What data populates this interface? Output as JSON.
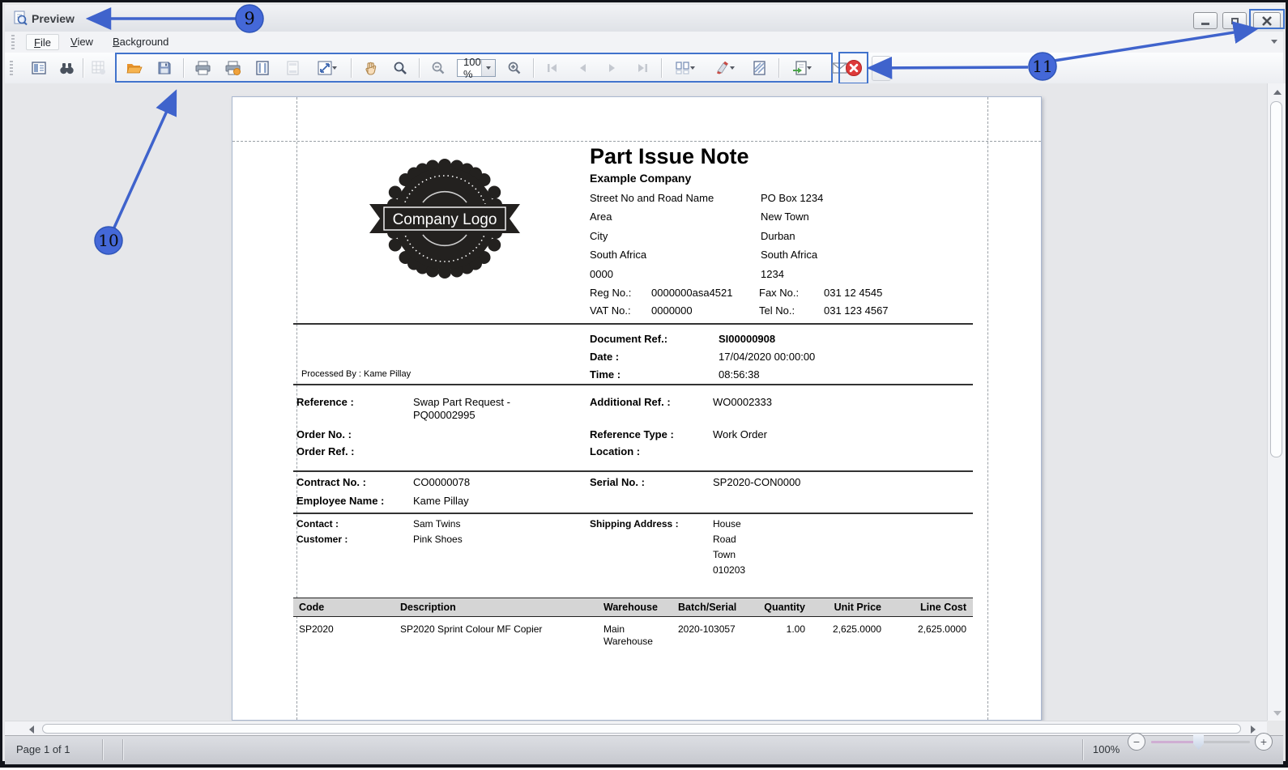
{
  "window": {
    "title": "Preview"
  },
  "menubar": {
    "items": [
      {
        "key": "F",
        "rest": "ile"
      },
      {
        "key": "V",
        "rest": "iew"
      },
      {
        "key": "B",
        "rest": "ackground"
      }
    ]
  },
  "toolbar": {
    "zoom_value": "100 %"
  },
  "statusbar": {
    "page_info": "Page 1 of 1",
    "zoom_label": "100%"
  },
  "annotations": {
    "n9": "9",
    "n10": "10",
    "n11": "11"
  },
  "logo": {
    "text": "Company Logo"
  },
  "icons": {
    "title": "preview-magnifier",
    "document_map": "split-panels",
    "search": "binoculars",
    "customize": "grid-gear",
    "open": "folder",
    "save": "floppy",
    "print": "printer",
    "quick_print": "printer-badge",
    "page_setup": "page-margins",
    "header_footer": "page-bands",
    "scale": "diagonal-arrows",
    "hand_tool": "hand",
    "magnifier": "magnifier",
    "zoom_out": "magnifier-minus",
    "zoom_in": "magnifier-plus",
    "first_page": "bar-left-arrow",
    "previous_page": "left-arrow",
    "next_page": "right-arrow",
    "last_page": "bar-right-arrow",
    "multiple_pages": "pages-grid",
    "page_color": "highlighter",
    "watermark": "page-hatch",
    "export": "page-export-arrow",
    "email": "envelope",
    "close_preview": "red-circle-x",
    "minimize": "dash",
    "maximize": "square",
    "close_window": "x"
  },
  "colors": {
    "annotation": "#3f63cc",
    "highlight": "#4173cc",
    "close_red": "#dd3a3a",
    "folder_orange": "#f0a23c",
    "header_band": "#d5d5d5"
  },
  "doc": {
    "title": "Part Issue Note",
    "company": "Example Company",
    "address_left": [
      "Street No and Road Name",
      "Area",
      "City",
      "South Africa",
      "0000"
    ],
    "address_right": [
      "PO Box 1234",
      "New Town",
      "Durban",
      "South Africa",
      "1234"
    ],
    "reg": {
      "label": "Reg No.:",
      "value": "0000000asa4521"
    },
    "fax": {
      "label": "Fax No.:",
      "value": "031 12 4545"
    },
    "vat": {
      "label": "VAT No.:",
      "value": "0000000"
    },
    "tel": {
      "label": "Tel No.:",
      "value": "031 123 4567"
    },
    "document_ref": {
      "label": "Document Ref.:",
      "value": "SI00000908"
    },
    "date": {
      "label": "Date :",
      "value": "17/04/2020 00:00:00"
    },
    "time": {
      "label": "Time :",
      "value": "08:56:38"
    },
    "processed_by": "Processed By : Kame Pillay",
    "reference": {
      "label": "Reference :",
      "value_line1": "Swap Part Request -",
      "value_line2": "PQ00002995"
    },
    "additional_ref": {
      "label": "Additional Ref. :",
      "value": "WO0002333"
    },
    "order_no": {
      "label": "Order No. :",
      "value": ""
    },
    "reference_type": {
      "label": "Reference Type :",
      "value": "Work Order"
    },
    "order_ref": {
      "label": "Order Ref. :",
      "value": ""
    },
    "location": {
      "label": "Location :",
      "value": ""
    },
    "contract_no": {
      "label": "Contract No. :",
      "value": "CO0000078"
    },
    "serial_no": {
      "label": "Serial No. :",
      "value": "SP2020-CON0000"
    },
    "employee_name": {
      "label": "Employee Name :",
      "value": "Kame Pillay"
    },
    "contact": {
      "label": "Contact :",
      "value": "Sam Twins"
    },
    "customer": {
      "label": "Customer :",
      "value": "Pink Shoes"
    },
    "shipping_address": {
      "label": "Shipping Address :",
      "lines": [
        "House",
        "Road",
        "Town",
        "010203"
      ]
    },
    "table": {
      "headers": [
        "Code",
        "Description",
        "Warehouse",
        "Batch/Serial",
        "Quantity",
        "Unit Price",
        "Line Cost"
      ],
      "rows": [
        {
          "code": "SP2020",
          "description": "SP2020 Sprint Colour MF Copier",
          "warehouse": "Main Warehouse",
          "batch_serial": "2020-103057",
          "quantity": "1.00",
          "unit_price": "2,625.0000",
          "line_cost": "2,625.0000"
        }
      ]
    }
  }
}
